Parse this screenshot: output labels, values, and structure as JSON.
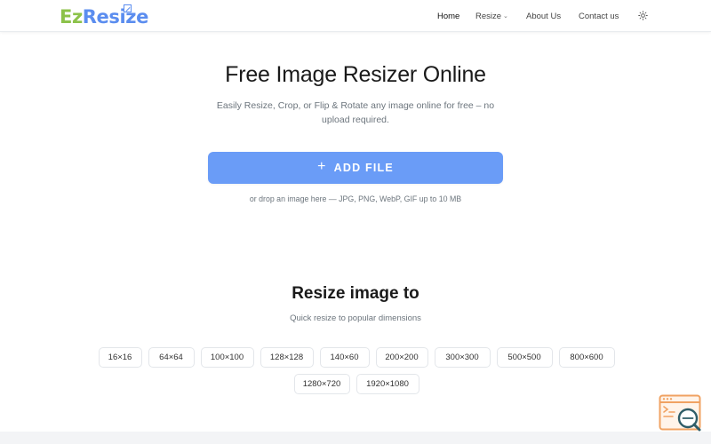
{
  "brand": {
    "part1": "Ez",
    "part2": "Resize"
  },
  "nav": {
    "home": "Home",
    "resize": "Resize",
    "about": "About Us",
    "contact": "Contact us"
  },
  "hero": {
    "title": "Free Image Resizer Online",
    "subtitle": "Easily Resize, Crop, or Flip & Rotate any image online for free – no upload required.",
    "add_file_label": "ADD FILE",
    "drop_hint": "or drop an image here — JPG, PNG, WebP, GIF up to 10 MB"
  },
  "resize_section": {
    "title": "Resize image to",
    "subtitle": "Quick resize to popular dimensions",
    "presets": [
      "16×16",
      "64×64",
      "100×100",
      "128×128",
      "140×60",
      "200×200",
      "300×300",
      "500×500",
      "800×600",
      "1280×720",
      "1920×1080"
    ]
  },
  "colors": {
    "accent": "#6a9cf7",
    "brand_green": "#8cc24a",
    "brand_blue": "#5b8def",
    "widget_orange": "#f0a262",
    "widget_teal": "#2f5d68"
  },
  "icons": {
    "theme_toggle": "sun-icon",
    "add": "plus-icon",
    "resize_menu": "chevron-down-icon",
    "help_widget": "search-chat-icon"
  }
}
